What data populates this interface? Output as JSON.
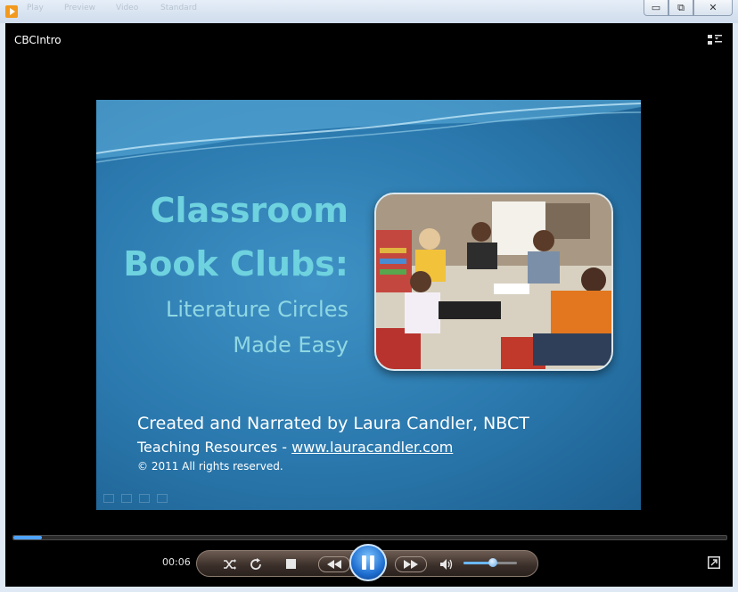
{
  "window": {
    "title": "CBCIntro",
    "menu_faded": [
      "Play",
      "Preview",
      "Video",
      "Standard"
    ],
    "buttons": {
      "minimize": "▭",
      "restore": "⧉",
      "close": "✕"
    }
  },
  "slide": {
    "title_line1": "Classroom",
    "title_line2": "Book Clubs:",
    "subtitle_line1": "Literature Circles",
    "subtitle_line2": "Made Easy",
    "credit_line1": "Created and Narrated by Laura Candler, NBCT",
    "credit_line2_prefix": "Teaching Resources - ",
    "credit_link": "www.lauracandler.com",
    "credit_line3": "© 2011 All rights reserved."
  },
  "player": {
    "elapsed": "00:06",
    "progress": 0.04,
    "volume": 0.55,
    "state": "playing",
    "icons": [
      "shuffle-icon",
      "repeat-icon",
      "stop-icon",
      "previous-icon",
      "pause-icon",
      "next-icon",
      "volume-icon",
      "fullscreen-icon",
      "switch-to-library-icon"
    ]
  },
  "colors": {
    "slide_bg": "#2a78ad",
    "title_color": "#6fd2df",
    "play_button": "#1f6fd1"
  }
}
